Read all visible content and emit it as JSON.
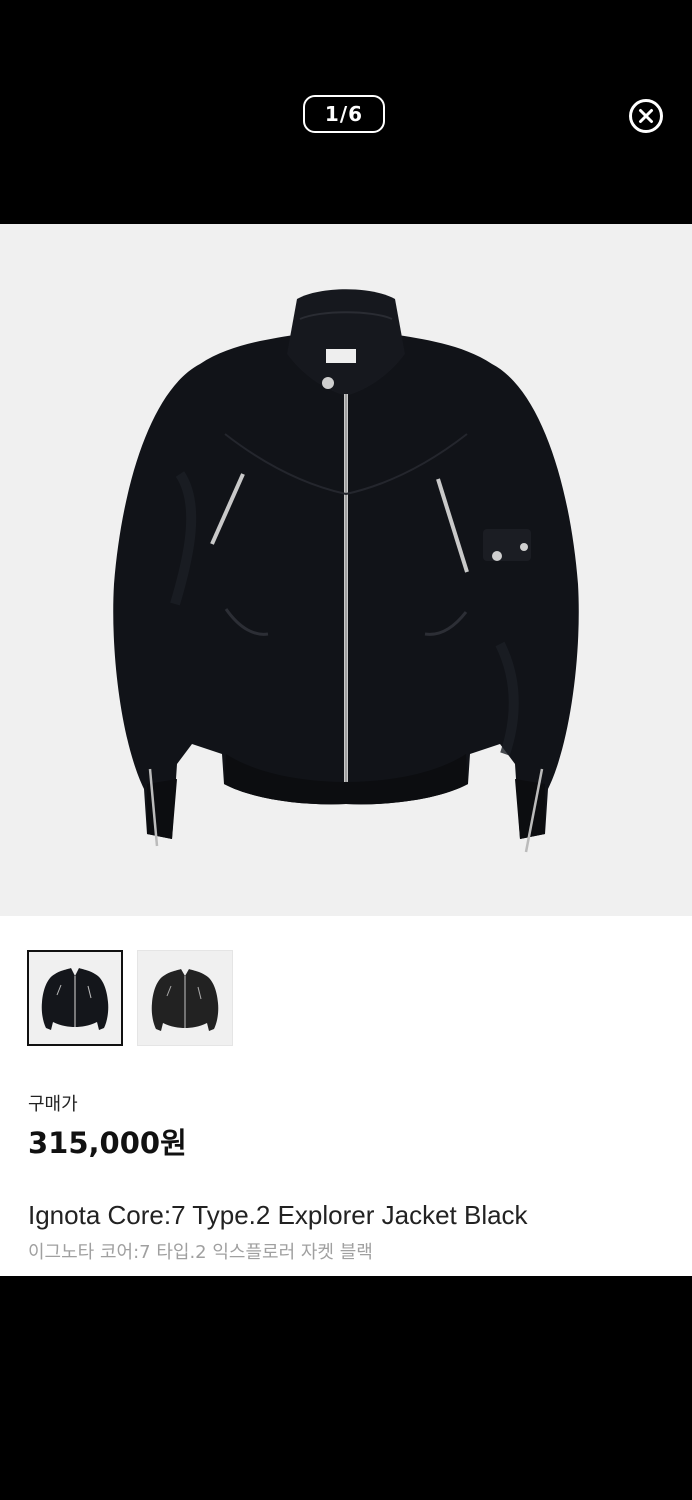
{
  "viewer": {
    "counter": "1/6",
    "close_icon": "close-circle-icon"
  },
  "hero": {
    "image_desc": "black-bomber-jacket-photo"
  },
  "thumbnails": [
    {
      "selected": true
    },
    {
      "selected": false
    }
  ],
  "product": {
    "price_label": "구매가",
    "price": "315,000원",
    "name_en": "Ignota Core:7 Type.2 Explorer Jacket Black",
    "name_ko": "이그노타 코어:7 타입.2 익스플로러 자켓 블랙"
  },
  "colors": {
    "background": "#000000",
    "image_bg": "#f0f0f0",
    "panel_bg": "#ffffff",
    "text_primary": "#111111",
    "text_muted": "#a0a0a0"
  }
}
